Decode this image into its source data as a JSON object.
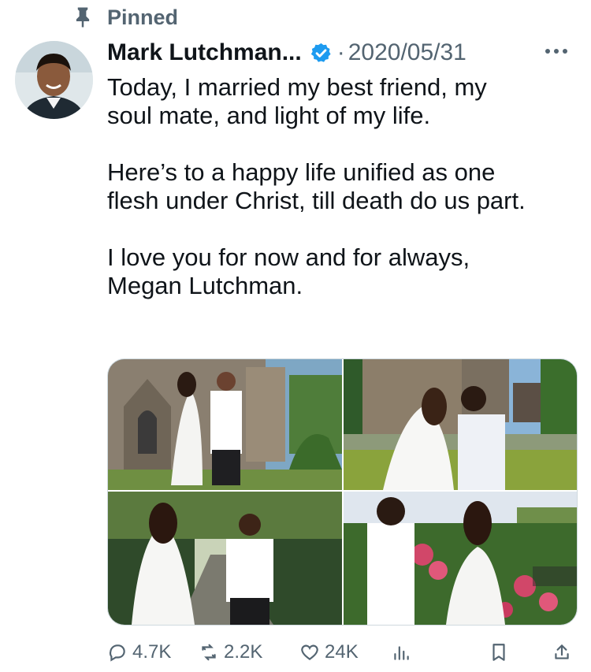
{
  "pinned": {
    "label": "Pinned"
  },
  "author": {
    "name": "Mark Lutchman...",
    "verified": true
  },
  "post": {
    "separator": "·",
    "date": "2020/05/31",
    "paragraphs": [
      "Today, I married my best friend, my\nsoul mate, and light of my life.",
      "Here’s to a happy life unified as one\nflesh under Christ, till death do us part.",
      "I love you for now and for always,\nMegan Lutchman."
    ]
  },
  "media": {
    "count": 4
  },
  "actions": {
    "replies": "4.7K",
    "reposts": "2.2K",
    "likes": "24K"
  },
  "colors": {
    "text": "#0f1419",
    "muted": "#536471",
    "verified": "#1d9bf0",
    "border": "#cfd9de"
  },
  "icons": [
    "pin-icon",
    "verified-icon",
    "more-icon",
    "reply-icon",
    "repost-icon",
    "like-icon",
    "views-icon",
    "bookmark-icon",
    "share-icon"
  ]
}
